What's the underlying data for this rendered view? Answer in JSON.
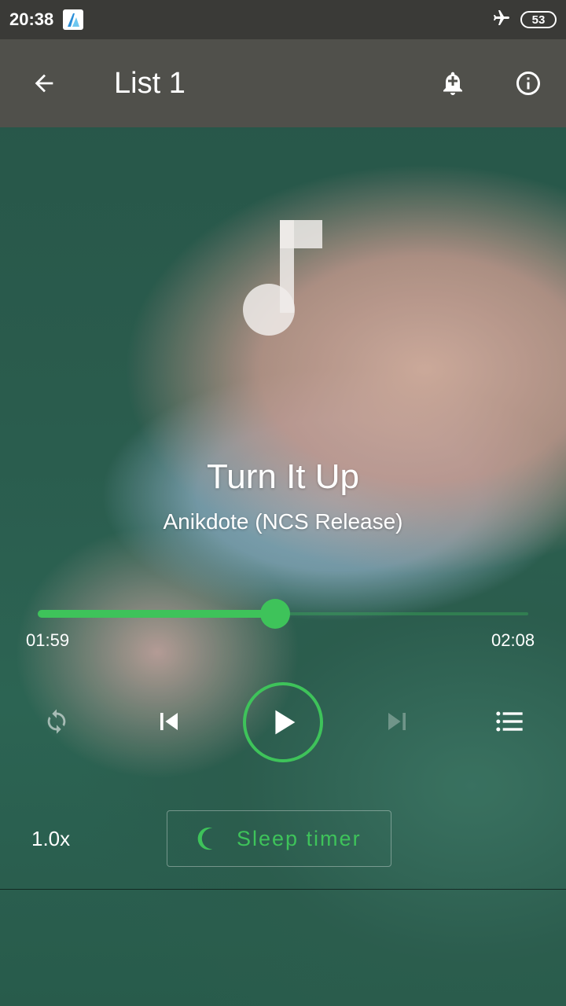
{
  "status_bar": {
    "time": "20:38",
    "battery_level": "53",
    "icons": [
      "app-logo-icon",
      "airplane-mode-icon",
      "battery-icon"
    ]
  },
  "toolbar": {
    "title": "List 1",
    "icons": [
      "back-arrow-icon",
      "add-alarm-icon",
      "info-icon"
    ]
  },
  "player": {
    "track_title": "Turn It Up",
    "track_artist": "Anikdote (NCS Release)",
    "current_time": "01:59",
    "total_time": "02:08",
    "progress_fraction": 0.484,
    "playback_speed": "1.0x",
    "sleep_timer_label": "Sleep timer",
    "controls": [
      "repeat-icon",
      "skip-previous-icon",
      "play-icon",
      "skip-next-icon",
      "queue-list-icon"
    ]
  },
  "colors": {
    "accent": "#3ec35a",
    "toolbar_bg": "#50504b",
    "statusbar_bg": "#3a3a37"
  }
}
